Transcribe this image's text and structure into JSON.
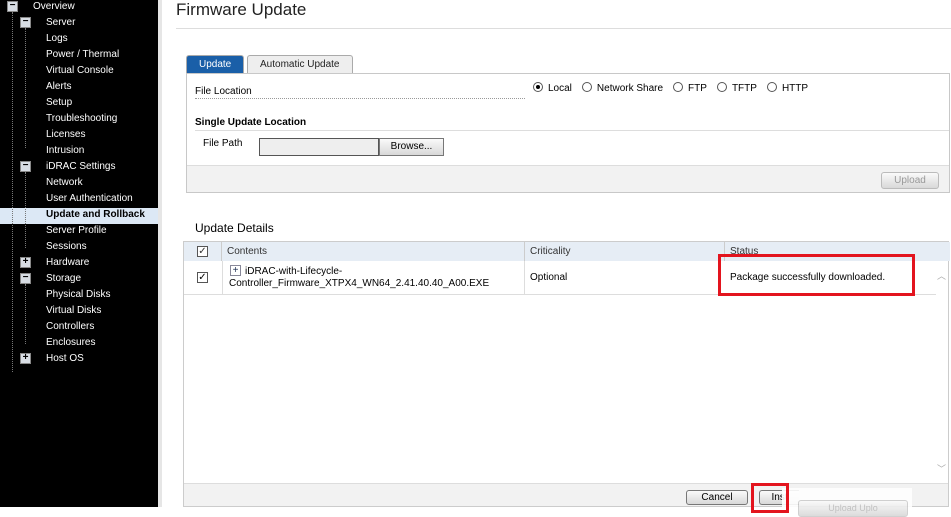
{
  "sidebar": {
    "items": [
      {
        "label": "Overview",
        "level": 0,
        "toggle": "minus"
      },
      {
        "label": "Server",
        "level": 1,
        "toggle": "minus"
      },
      {
        "label": "Logs",
        "level": 2
      },
      {
        "label": "Power / Thermal",
        "level": 2
      },
      {
        "label": "Virtual Console",
        "level": 2
      },
      {
        "label": "Alerts",
        "level": 2
      },
      {
        "label": "Setup",
        "level": 2
      },
      {
        "label": "Troubleshooting",
        "level": 2
      },
      {
        "label": "Licenses",
        "level": 2
      },
      {
        "label": "Intrusion",
        "level": 2
      },
      {
        "label": "iDRAC Settings",
        "level": 1,
        "toggle": "minus"
      },
      {
        "label": "Network",
        "level": 2
      },
      {
        "label": "User Authentication",
        "level": 2
      },
      {
        "label": "Update and Rollback",
        "level": 2,
        "selected": true
      },
      {
        "label": "Server Profile",
        "level": 2
      },
      {
        "label": "Sessions",
        "level": 2
      },
      {
        "label": "Hardware",
        "level": 1,
        "toggle": "plus"
      },
      {
        "label": "Storage",
        "level": 1,
        "toggle": "minus"
      },
      {
        "label": "Physical Disks",
        "level": 2
      },
      {
        "label": "Virtual Disks",
        "level": 2
      },
      {
        "label": "Controllers",
        "level": 2
      },
      {
        "label": "Enclosures",
        "level": 2
      },
      {
        "label": "Host OS",
        "level": 1,
        "toggle": "plus"
      }
    ]
  },
  "page": {
    "title": "Firmware Update"
  },
  "tabs": {
    "update": "Update",
    "automatic": "Automatic Update"
  },
  "form": {
    "file_location_label": "File Location",
    "options": [
      "Local",
      "Network Share",
      "FTP",
      "TFTP",
      "HTTP"
    ],
    "selected": "Local",
    "section_title": "Single Update Location",
    "file_path_label": "File Path",
    "file_path_value": "",
    "browse": "Browse...",
    "upload": "Upload"
  },
  "details": {
    "title": "Update Details",
    "columns": [
      "Contents",
      "Criticality",
      "Status"
    ],
    "rows": [
      {
        "checked": true,
        "contents_line1": "iDRAC-with-Lifecycle-",
        "contents_line2": "Controller_Firmware_XTPX4_WN64_2.41.40.40_A00.EXE",
        "criticality": "Optional",
        "status": "Package successfully downloaded."
      }
    ]
  },
  "footer": {
    "cancel": "Cancel",
    "install": "Inst",
    "upload_partial": "Upload    Uplo"
  },
  "colors": {
    "accent": "#1a5fa8",
    "highlight": "#e3141e",
    "sidebar_bg": "#000000",
    "selected_bg": "#dce8f5"
  }
}
